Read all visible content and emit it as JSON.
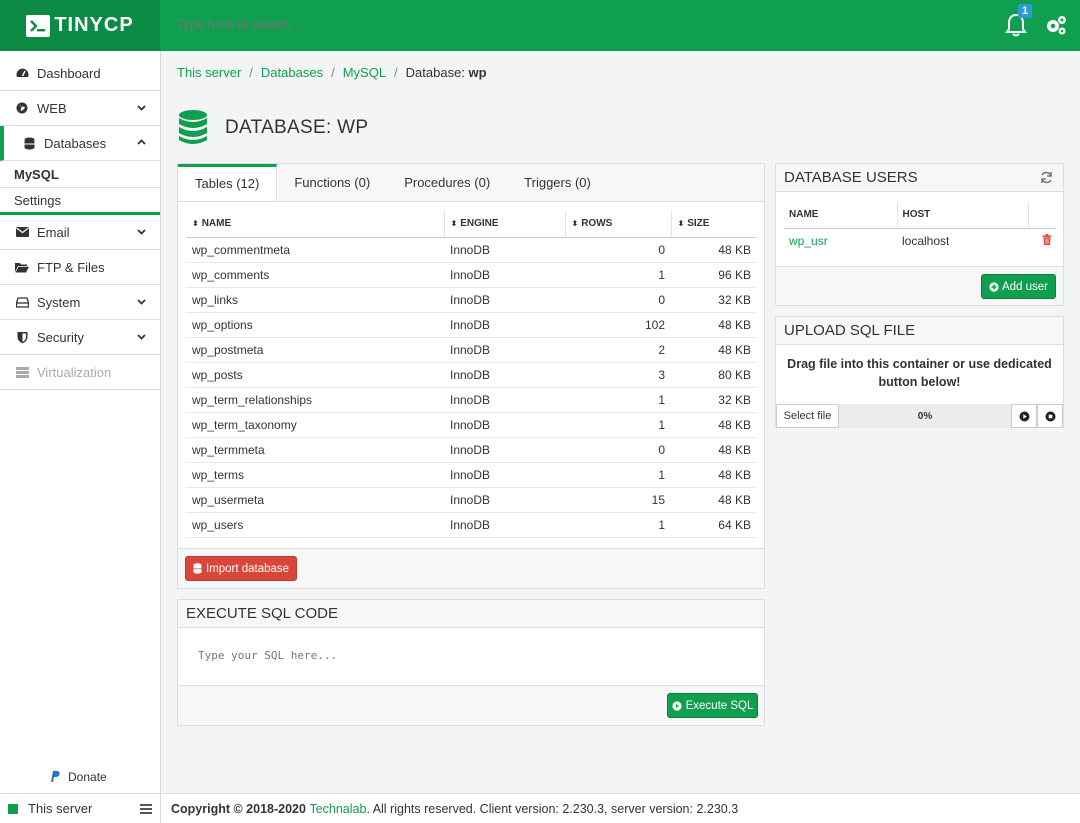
{
  "app": {
    "logo_text": "TINYCP",
    "search_placeholder": "Type here to search...",
    "notification_count": "1",
    "accent": "#109e4f"
  },
  "sidebar": {
    "items": [
      {
        "label": "Dashboard",
        "icon": "dashboard-icon"
      },
      {
        "label": "WEB",
        "icon": "globe-icon"
      },
      {
        "label": "Databases",
        "icon": "database-icon"
      },
      {
        "label": "Email",
        "icon": "envelope-icon"
      },
      {
        "label": "FTP & Files",
        "icon": "folder-icon"
      },
      {
        "label": "System",
        "icon": "hdd-icon"
      },
      {
        "label": "Security",
        "icon": "shield-icon"
      },
      {
        "label": "Virtualization",
        "icon": "server-icon"
      }
    ],
    "sub_items": [
      "MySQL",
      "Settings"
    ],
    "donate": "Donate",
    "server": "This server"
  },
  "breadcrumb": {
    "items": [
      "This server",
      "Databases",
      "MySQL"
    ],
    "current_prefix": "Database: ",
    "current_name": "wp"
  },
  "page_title": "DATABASE: WP",
  "tabs": [
    "Tables (12)",
    "Functions (0)",
    "Procedures (0)",
    "Triggers (0)"
  ],
  "tables": {
    "columns": [
      "NAME",
      "ENGINE",
      "ROWS",
      "SIZE"
    ],
    "rows": [
      [
        "wp_commentmeta",
        "InnoDB",
        "0",
        "48 KB"
      ],
      [
        "wp_comments",
        "InnoDB",
        "1",
        "96 KB"
      ],
      [
        "wp_links",
        "InnoDB",
        "0",
        "32 KB"
      ],
      [
        "wp_options",
        "InnoDB",
        "102",
        "48 KB"
      ],
      [
        "wp_postmeta",
        "InnoDB",
        "2",
        "48 KB"
      ],
      [
        "wp_posts",
        "InnoDB",
        "3",
        "80 KB"
      ],
      [
        "wp_term_relationships",
        "InnoDB",
        "1",
        "32 KB"
      ],
      [
        "wp_term_taxonomy",
        "InnoDB",
        "1",
        "48 KB"
      ],
      [
        "wp_termmeta",
        "InnoDB",
        "0",
        "48 KB"
      ],
      [
        "wp_terms",
        "InnoDB",
        "1",
        "48 KB"
      ],
      [
        "wp_usermeta",
        "InnoDB",
        "15",
        "48 KB"
      ],
      [
        "wp_users",
        "InnoDB",
        "1",
        "64 KB"
      ]
    ],
    "import_label": "Import database"
  },
  "sql": {
    "title": "EXECUTE SQL CODE",
    "placeholder": "Type your SQL here...",
    "execute_label": "Execute SQL"
  },
  "users": {
    "title": "DATABASE USERS",
    "columns": [
      "NAME",
      "HOST"
    ],
    "rows": [
      [
        "wp_usr",
        "localhost"
      ]
    ],
    "add_label": "Add user"
  },
  "upload": {
    "title": "UPLOAD SQL FILE",
    "line1": "Drag file into this container or use dedicated",
    "line2": "button below!",
    "select_label": "Select file",
    "progress": "0%"
  },
  "footer": {
    "prefix": "Copyright © 2018-2020 ",
    "company": "Technalab",
    "suffix": ". All rights reserved. Client version: 2.230.3, server version: 2.230.3"
  }
}
